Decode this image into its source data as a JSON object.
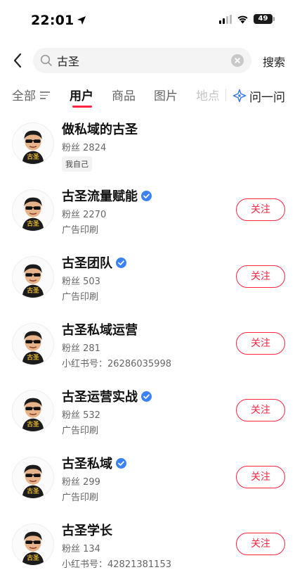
{
  "status_bar": {
    "time": "22:01",
    "battery": "49"
  },
  "search": {
    "value": "古圣",
    "submit_label": "搜索"
  },
  "tabs": [
    {
      "label": "全部"
    },
    {
      "label": "用户"
    },
    {
      "label": "商品"
    },
    {
      "label": "图片"
    },
    {
      "label": "地点"
    }
  ],
  "ask_tab": {
    "label": "问一问"
  },
  "colors": {
    "accent": "#ff2442",
    "verified": "#3b82f6"
  },
  "users": [
    {
      "name": "做私域的古圣",
      "fans": "粉丝 2824",
      "tag": "我自己"
    },
    {
      "name": "古圣流量赋能",
      "verified": true,
      "fans": "粉丝 2270",
      "sub": "广告印刷",
      "follow": "关注"
    },
    {
      "name": "古圣团队",
      "verified": true,
      "fans": "粉丝 503",
      "sub": "广告印刷",
      "follow": "关注"
    },
    {
      "name": "古圣私域运营",
      "fans": "粉丝 281",
      "sub": "小红书号：26286035998",
      "follow": "关注"
    },
    {
      "name": "古圣运营实战",
      "verified": true,
      "fans": "粉丝 532",
      "sub": "广告印刷",
      "follow": "关注"
    },
    {
      "name": "古圣私域",
      "verified": true,
      "fans": "粉丝 299",
      "sub": "广告印刷",
      "follow": "关注"
    },
    {
      "name": "古圣学长",
      "fans": "粉丝 134",
      "sub": "小红书号：42821381153",
      "follow": "关注"
    }
  ]
}
